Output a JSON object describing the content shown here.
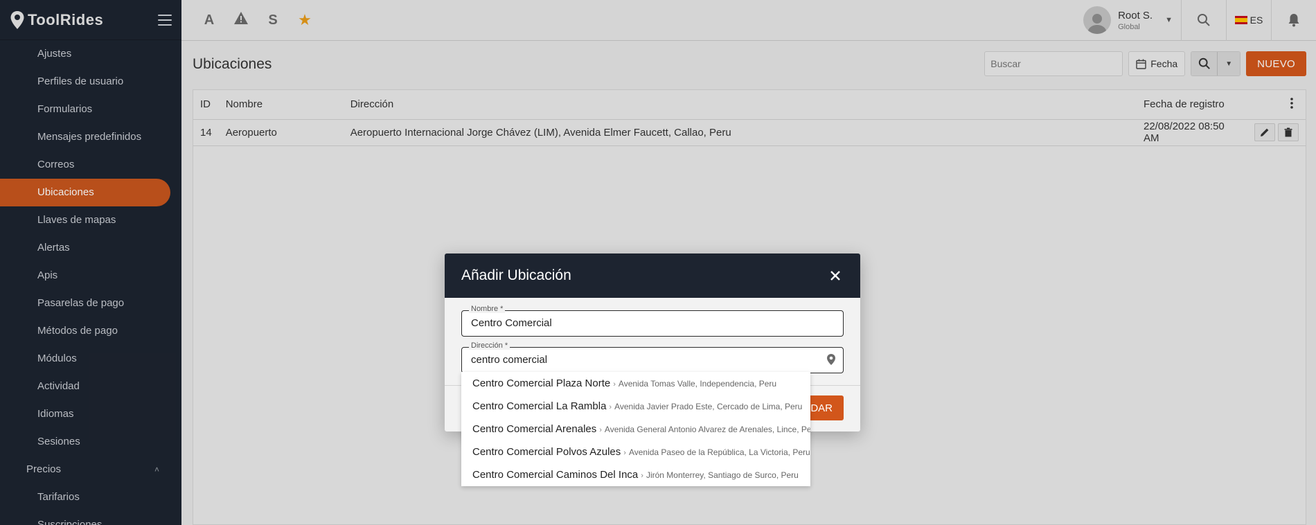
{
  "app": {
    "name": "ToolRides"
  },
  "sidebar": {
    "items": [
      {
        "label": "Ajustes",
        "active": false
      },
      {
        "label": "Perfiles de usuario",
        "active": false
      },
      {
        "label": "Formularios",
        "active": false
      },
      {
        "label": "Mensajes predefinidos",
        "active": false
      },
      {
        "label": "Correos",
        "active": false
      },
      {
        "label": "Ubicaciones",
        "active": true
      },
      {
        "label": "Llaves de mapas",
        "active": false
      },
      {
        "label": "Alertas",
        "active": false
      },
      {
        "label": "Apis",
        "active": false
      },
      {
        "label": "Pasarelas de pago",
        "active": false
      },
      {
        "label": "Métodos de pago",
        "active": false
      },
      {
        "label": "Módulos",
        "active": false
      },
      {
        "label": "Actividad",
        "active": false
      },
      {
        "label": "Idiomas",
        "active": false
      },
      {
        "label": "Sesiones",
        "active": false
      }
    ],
    "group": {
      "label": "Precios",
      "expanded": true
    },
    "group_items": [
      {
        "label": "Tarifarios"
      },
      {
        "label": "Suscripciones"
      }
    ]
  },
  "topbar": {
    "quick": [
      "A",
      "S"
    ],
    "user": {
      "name": "Root S.",
      "role": "Global"
    },
    "language": "ES"
  },
  "page": {
    "title": "Ubicaciones",
    "search_placeholder": "Buscar",
    "date_button": "Fecha",
    "new_button": "NUEVO"
  },
  "table": {
    "headers": {
      "id": "ID",
      "name": "Nombre",
      "address": "Dirección",
      "date": "Fecha de registro"
    },
    "rows": [
      {
        "id": "14",
        "name": "Aeropuerto",
        "address": "Aeropuerto Internacional Jorge Chávez (LIM), Avenida Elmer Faucett, Callao, Peru",
        "date": "22/08/2022 08:50 AM"
      }
    ]
  },
  "modal": {
    "title": "Añadir Ubicación",
    "name_label": "Nombre *",
    "name_value": "Centro Comercial",
    "address_label": "Dirección *",
    "address_value": "centro comercial",
    "save_button": "GUARDAR",
    "save_visible": "DAR"
  },
  "autocomplete": [
    {
      "main": "Centro Comercial Plaza Norte",
      "sub": "Avenida Tomas Valle, Independencia, Peru"
    },
    {
      "main": "Centro Comercial La Rambla",
      "sub": "Avenida Javier Prado Este, Cercado de Lima, Peru"
    },
    {
      "main": "Centro Comercial Arenales",
      "sub": "Avenida General Antonio Alvarez de Arenales, Lince, Pe"
    },
    {
      "main": "Centro Comercial Polvos Azules",
      "sub": "Avenida Paseo de la República, La Victoria, Peru"
    },
    {
      "main": "Centro Comercial Caminos Del Inca",
      "sub": "Jirón Monterrey, Santiago de Surco, Peru"
    }
  ],
  "colors": {
    "accent": "#d2561b",
    "sidebar": "#1d2430",
    "star": "#e89c1a"
  }
}
